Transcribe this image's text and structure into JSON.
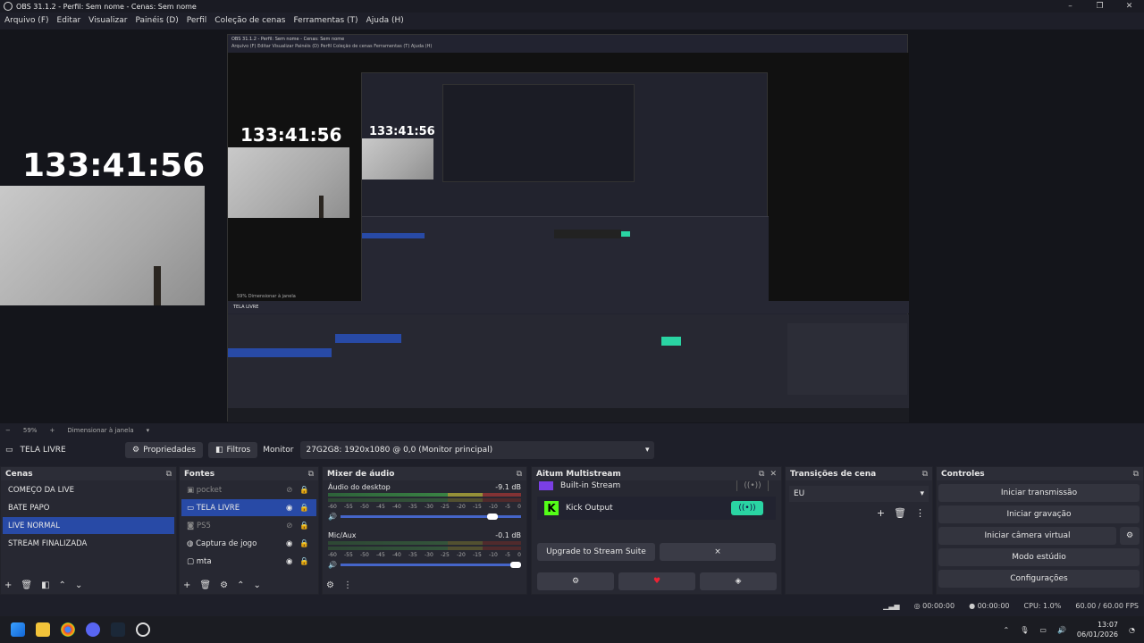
{
  "window": {
    "title": "OBS 31.1.2 - Perfil: Sem nome - Cenas: Sem nome"
  },
  "menu": [
    "Arquivo (F)",
    "Editar",
    "Visualizar",
    "Painéis (D)",
    "Perfil",
    "Coleção de cenas",
    "Ferramentas (T)",
    "Ajuda (H)"
  ],
  "preview": {
    "timer": "133:41:56"
  },
  "zoom": {
    "level": "59%",
    "mode": "Dimensionar à janela"
  },
  "source_bar": {
    "scene_name": "TELA LIVRE",
    "properties": "Propriedades",
    "filters": "Filtros",
    "monitor_label": "Monitor",
    "monitor_value": "27G2G8: 1920x1080 @ 0,0 (Monitor principal)"
  },
  "scenes": {
    "title": "Cenas",
    "items": [
      "COMEÇO DA LIVE",
      "BATE PAPO",
      "LIVE NORMAL",
      "STREAM FINALIZADA"
    ],
    "selected": 2
  },
  "sources": {
    "title": "Fontes",
    "items": [
      "pocket",
      "TELA LIVRE",
      "PS5",
      "Captura de jogo",
      "mta"
    ]
  },
  "mixer": {
    "title": "Mixer de áudio",
    "channels": [
      {
        "name": "Áudio do desktop",
        "db": "-9.1 dB",
        "volume": 0.87
      },
      {
        "name": "Mic/Aux",
        "db": "-0.1 dB",
        "volume": 1.0
      }
    ],
    "scale": [
      "-60",
      "-55",
      "-50",
      "-45",
      "-40",
      "-35",
      "-30",
      "-25",
      "-20",
      "-15",
      "-10",
      "-5",
      "0"
    ]
  },
  "multistream": {
    "title": "Aitum Multistream",
    "partial_item": "Built-in Stream",
    "kick_label": "Kick Output",
    "upgrade": "Upgrade to Stream Suite",
    "close": "×"
  },
  "transitions": {
    "title": "Transições de cena",
    "value": "EU"
  },
  "controls": {
    "title": "Controles",
    "start_stream": "Iniciar transmissão",
    "start_record": "Iniciar gravação",
    "virtual_cam": "Iniciar câmera virtual",
    "studio": "Modo estúdio",
    "settings": "Configurações"
  },
  "status": {
    "time1": "00:00:00",
    "time2": "00:00:00",
    "cpu": "CPU: 1.0%",
    "fps": "60.00 / 60.00 FPS"
  },
  "taskbar": {
    "time": "13:07",
    "date": "06/01/2026"
  },
  "nested": {
    "title": "OBS 31.1.2 - Perfil: Sem nome - Cenas: Sem nome",
    "menu": "Arquivo (F)   Editar   Visualizar   Painéis (D)   Perfil   Coleção de cenas   Ferramentas (T)   Ajuda (H)",
    "zoom": "59%   Dimensionar à janela"
  },
  "colors": {
    "accent": "#284aa6",
    "toggle_on": "#2ad4a3",
    "kick": "#53fc18"
  }
}
